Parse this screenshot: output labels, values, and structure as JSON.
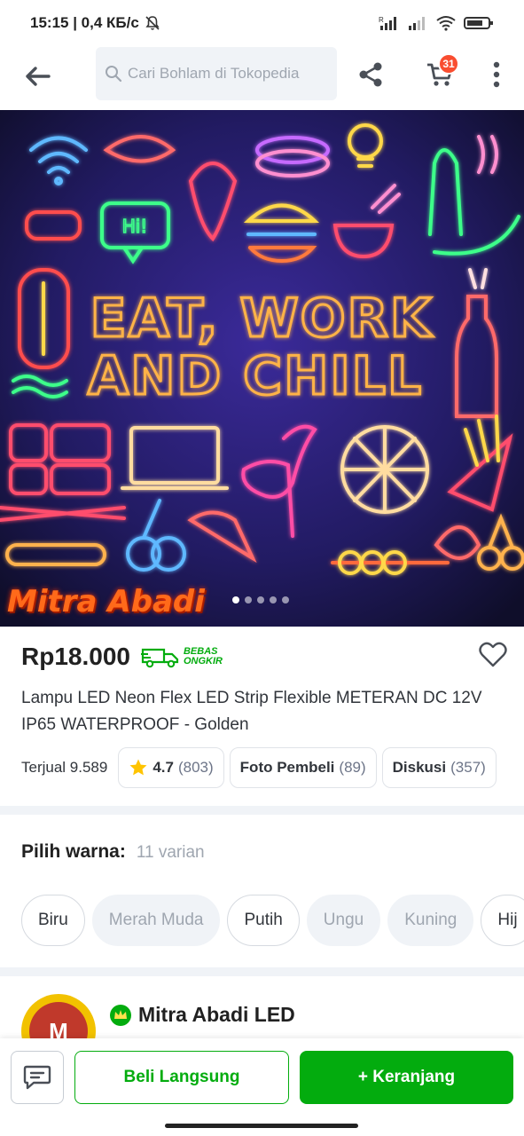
{
  "status": {
    "time_speed": "15:15 | 0,4 КБ/с"
  },
  "header": {
    "search_placeholder": "Cari Bohlam di Tokopedia",
    "cart_count": "31"
  },
  "hero": {
    "neon_line1": "EAT, WORK",
    "neon_line2": "AND CHILL",
    "watermark": "Mitra Abadi",
    "bubble_text": "Hi!",
    "dots": 5,
    "active_dot": 0
  },
  "product": {
    "price": "Rp18.000",
    "free_shipping_line1": "BEBAS",
    "free_shipping_line2": "ONGKIR",
    "title": "Lampu LED Neon Flex LED Strip Flexible METERAN DC 12V IP65 WATERPROOF - Golden",
    "sold": "Terjual 9.589",
    "rating": "4.7",
    "rating_count": "(803)",
    "photo_label": "Foto Pembeli",
    "photo_count": "(89)",
    "discussion_label": "Diskusi",
    "discussion_count": "(357)"
  },
  "variants": {
    "label": "Pilih warna:",
    "count": "11 varian",
    "options": [
      {
        "label": "Biru",
        "available": true
      },
      {
        "label": "Merah Muda",
        "available": false
      },
      {
        "label": "Putih",
        "available": true
      },
      {
        "label": "Ungu",
        "available": false
      },
      {
        "label": "Kuning",
        "available": false
      },
      {
        "label": "Hij",
        "available": true
      }
    ]
  },
  "shop": {
    "name": "Mitra Abadi LED",
    "logo_text": "M"
  },
  "actions": {
    "buy_now": "Beli Langsung",
    "add_to_cart": "+ Keranjang"
  },
  "colors": {
    "brand_green": "#03ac0e",
    "badge_red": "#f94d30"
  }
}
